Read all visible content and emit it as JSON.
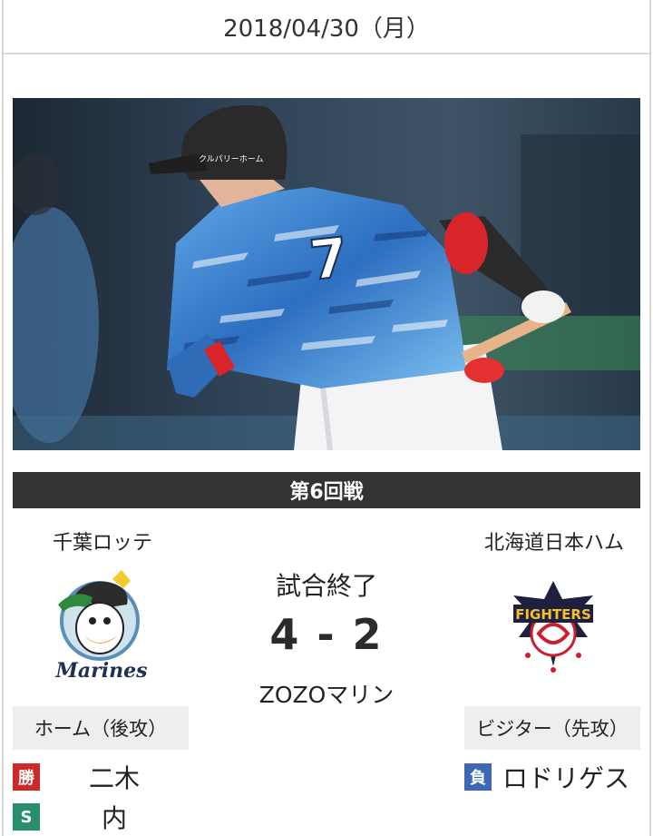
{
  "header": {
    "date": "2018/04/30（月）"
  },
  "game": {
    "round_label": "第6回戦",
    "status": "試合終了",
    "score": "4 - 2",
    "stadium": "ZOZOマリン"
  },
  "home": {
    "team_name": "千葉ロッテ",
    "side_label": "ホーム（後攻）",
    "logo_icon": "marines-logo-icon",
    "logo_text": "Marines",
    "pitchers": [
      {
        "badge": "勝",
        "badge_color": "#cc2a2a",
        "name": "二木"
      },
      {
        "badge": "S",
        "badge_color": "#27906a",
        "name": "内"
      }
    ]
  },
  "visitor": {
    "team_name": "北海道日本ハム",
    "side_label": "ビジター（先攻）",
    "logo_icon": "fighters-logo-icon",
    "logo_text": "FIGHTERS",
    "pitchers": [
      {
        "badge": "負",
        "badge_color": "#3e67b4",
        "name": "ロドリゲス"
      }
    ]
  },
  "photo": {
    "icon": "batter-photo",
    "jersey_number": "7",
    "helmet_text": "クルパリーホーム"
  },
  "colors": {
    "bar": "#333333",
    "label_bg": "#eeeeee",
    "win": "#cc2a2a",
    "save": "#27906a",
    "loss": "#3e67b4"
  }
}
